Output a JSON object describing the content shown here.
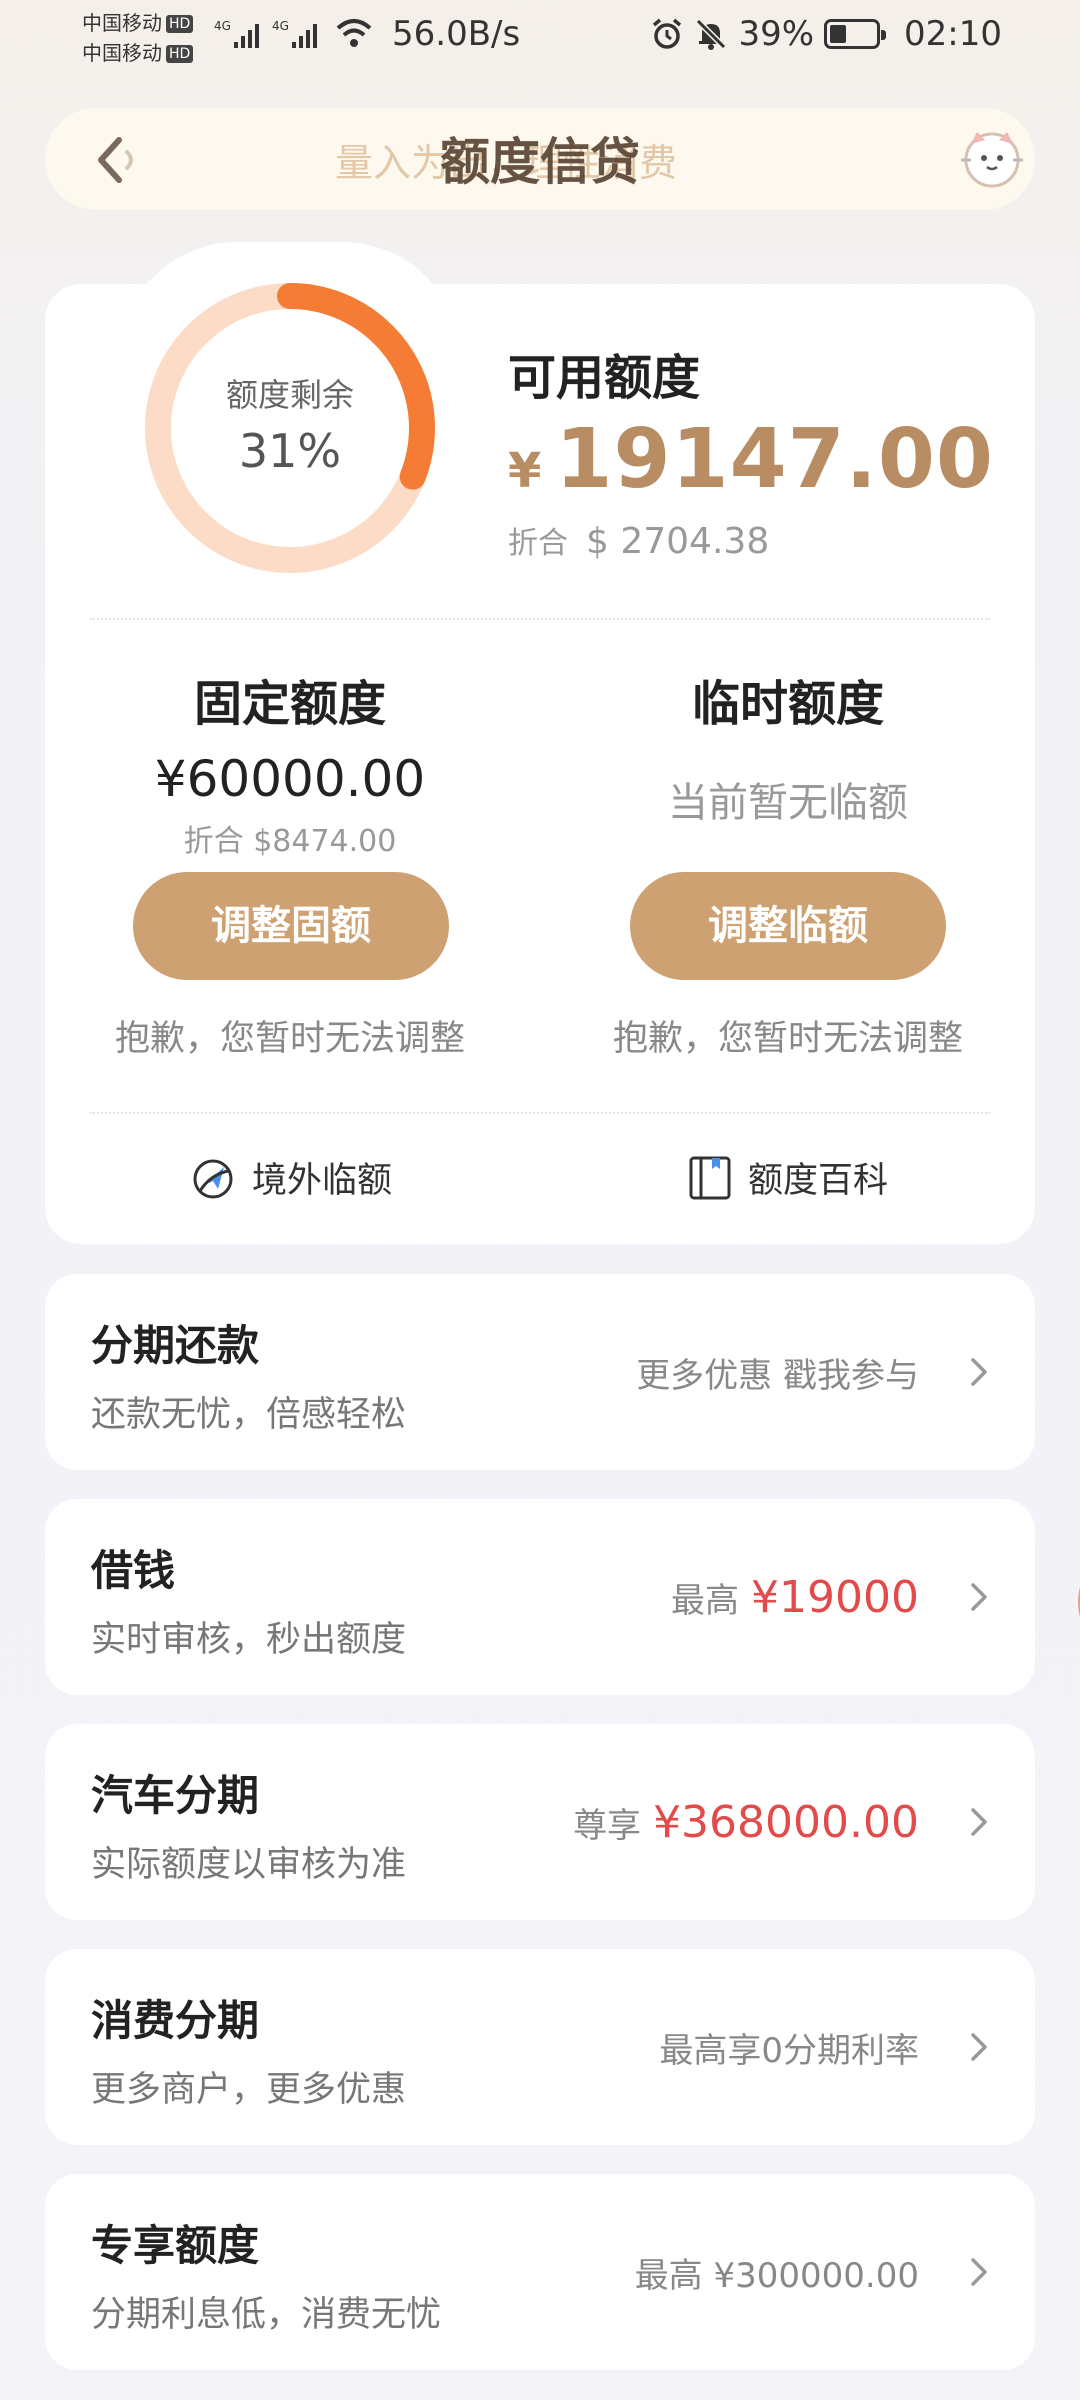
{
  "status_bar": {
    "carrier1": "中国移动",
    "carrier2": "中国移动",
    "hd": "HD",
    "net_speed": "56.0B/s",
    "battery": "39%",
    "time": "02:10"
  },
  "header": {
    "title": "额度信贷",
    "marquee": "量入为出，理性消费"
  },
  "credit": {
    "ring_label": "额度剩余",
    "ring_percent": "31%",
    "ring_fraction": 0.31,
    "available_title": "可用额度",
    "currency_symbol": "¥",
    "available_amount": "19147.00",
    "usd_label": "折合",
    "usd_amount": "$ 2704.38",
    "fixed": {
      "title": "固定额度",
      "amount": "¥60000.00",
      "usd": "折合 $8474.00",
      "button": "调整固额",
      "note": "抱歉，您暂时无法调整"
    },
    "temp": {
      "title": "临时额度",
      "status": "当前暂无临额",
      "button": "调整临额",
      "note": "抱歉，您暂时无法调整"
    },
    "links": {
      "overseas": "境外临额",
      "encyclopedia": "额度百科"
    }
  },
  "rows": [
    {
      "title": "分期还款",
      "subtitle": "还款无忧，倍感轻松",
      "right_label": "更多优惠 戳我参与",
      "right_value": ""
    },
    {
      "title": "借钱",
      "subtitle": "实时审核，秒出额度",
      "right_label": "最高",
      "right_value": "¥19000"
    },
    {
      "title": "汽车分期",
      "subtitle": "实际额度以审核为准",
      "right_label": "尊享",
      "right_value": "¥368000.00"
    },
    {
      "title": "消费分期",
      "subtitle": "更多商户，更多优惠",
      "right_label": "最高享0分期利率",
      "right_value": ""
    },
    {
      "title": "专享额度",
      "subtitle": "分期利息低，消费无忧",
      "right_label": "最高 ¥300000.00",
      "right_value": ""
    }
  ],
  "colors": {
    "gold": "#cda171",
    "amount_gold": "#b88d63",
    "ring_orange": "#f47c35",
    "ring_track": "#fcdcc7",
    "red": "#e34a4a"
  }
}
